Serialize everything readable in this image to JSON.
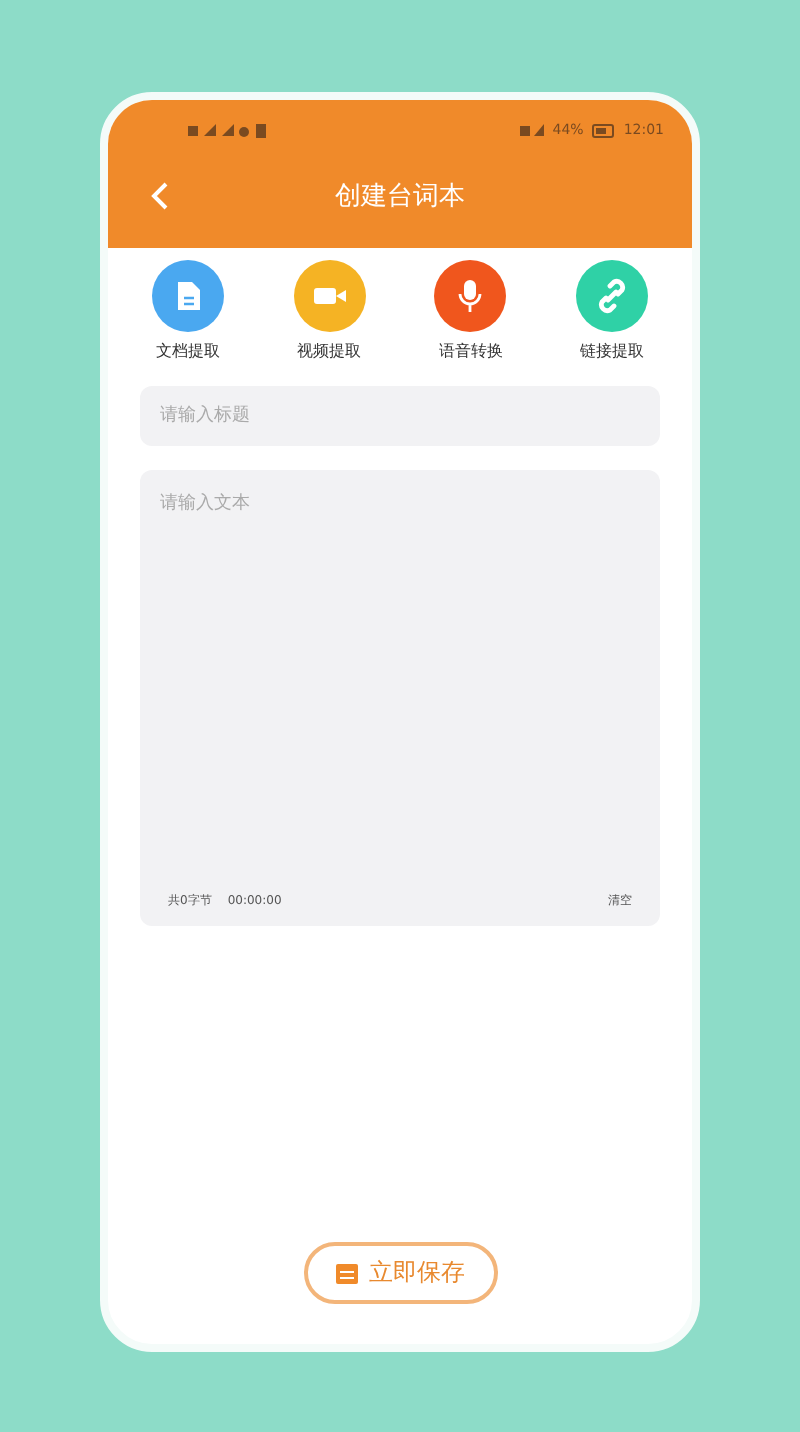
{
  "status_bar": {
    "battery": "44%",
    "time": "12:01"
  },
  "header": {
    "title": "创建台词本"
  },
  "tools": [
    {
      "kind": "document",
      "label": "文档提取",
      "color": "#4aa8f0"
    },
    {
      "kind": "video",
      "label": "视频提取",
      "color": "#f5b324"
    },
    {
      "kind": "voice",
      "label": "语音转换",
      "color": "#f0561d"
    },
    {
      "kind": "link",
      "label": "链接提取",
      "color": "#2fd1a6"
    }
  ],
  "title_field": {
    "placeholder": "请输入标题"
  },
  "text_field": {
    "placeholder": "请输入文本",
    "word_count": "共0字节",
    "duration": "00:00:00",
    "clear": "清空"
  },
  "save_button": {
    "label": "立即保存"
  }
}
